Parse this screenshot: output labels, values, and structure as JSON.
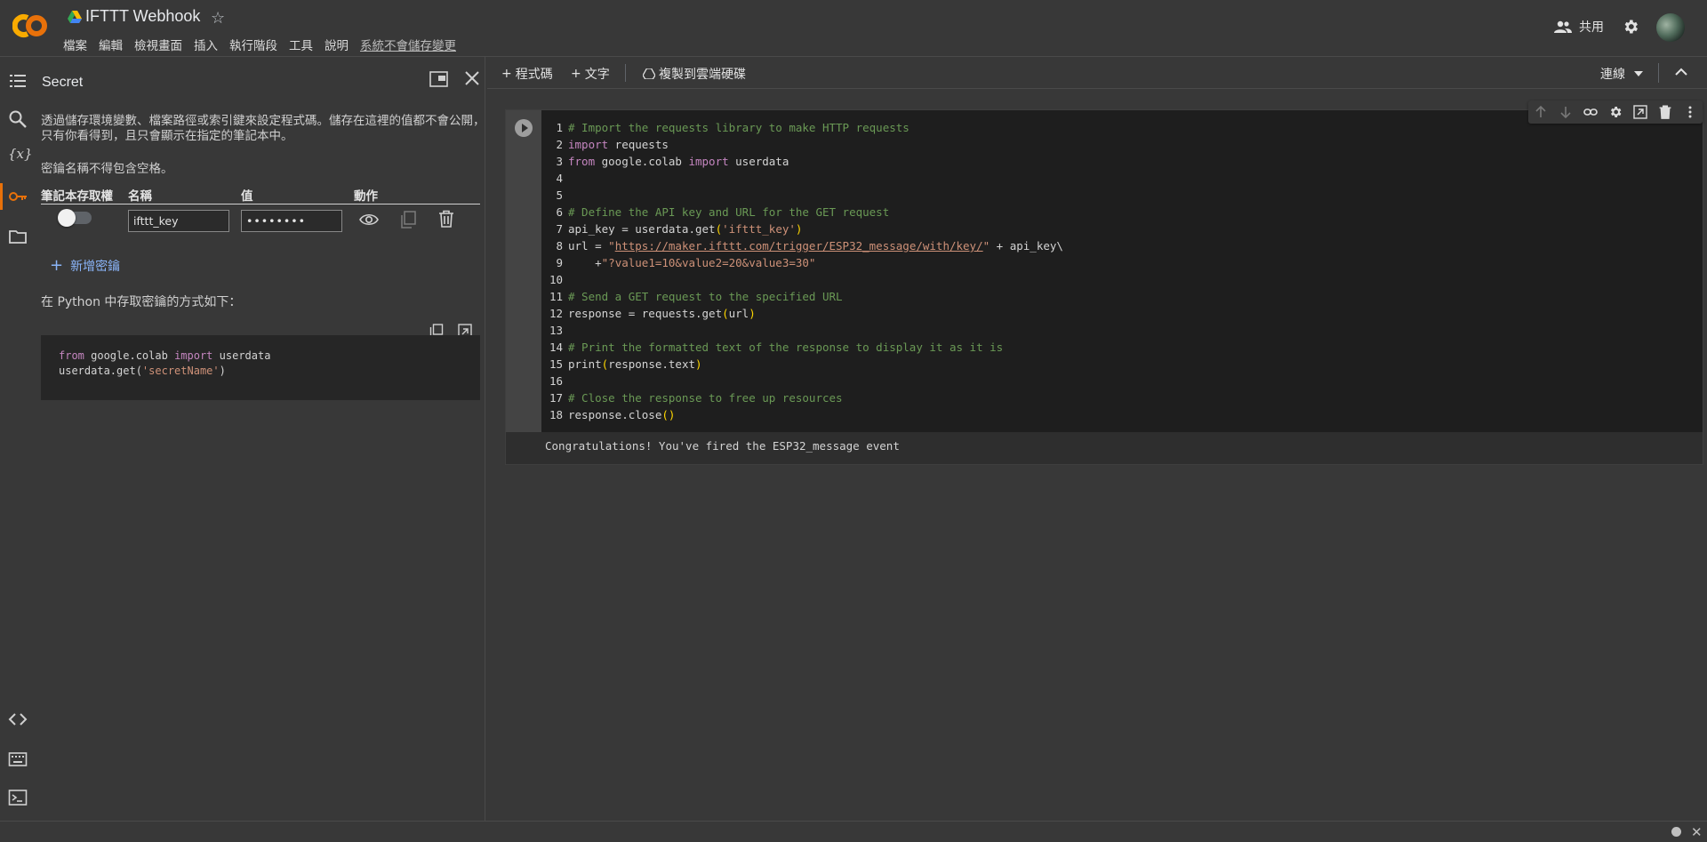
{
  "header": {
    "title": "IFTTT Webhook",
    "menu": [
      "檔案",
      "編輯",
      "檢視畫面",
      "插入",
      "執行階段",
      "工具",
      "說明"
    ],
    "unsaved_notice": "系統不會儲存變更",
    "share_label": "共用"
  },
  "side_panel": {
    "title": "Secret",
    "description": "透過儲存環境變數、檔案路徑或索引鍵來設定程式碼。儲存在這裡的值都不會公開，只有你看得到，且只會顯示在指定的筆記本中。",
    "note": "密鑰名稱不得包含空格。",
    "columns": [
      "筆記本存取權",
      "名稱",
      "值",
      "動作"
    ],
    "secret": {
      "name": "ifttt_key",
      "value_masked": "••••••••",
      "notebook_access": false
    },
    "add_secret_label": "新增密鑰",
    "python_note": "在 Python 中存取密鑰的方式如下：",
    "snippet": {
      "line1": [
        "from",
        " google.colab ",
        "import",
        " userdata"
      ],
      "line2": [
        "userdata.get(",
        "'secretName'",
        ")"
      ]
    }
  },
  "toolbar": {
    "add_code": "程式碼",
    "add_text": "文字",
    "copy_to_drive": "複製到雲端硬碟",
    "connect": "連線"
  },
  "cell": {
    "line_numbers": "1\n2\n3\n4\n5\n6\n7\n8\n9\n10\n11\n12\n13\n14\n15\n16\n17\n18",
    "code": {
      "l1": "# Import the requests library to make HTTP requests",
      "l2a": "import",
      "l2b": " requests",
      "l3a": "from",
      "l3b": " google.colab ",
      "l3c": "import",
      "l3d": " userdata",
      "l6": "# Define the API key and URL for the GET request",
      "l7a": "api_key = userdata.get",
      "l7b": "(",
      "l7c": "'ifttt_key'",
      "l7d": ")",
      "l8a": "url = ",
      "l8b": "\"",
      "l8c": "https://maker.ifttt.com/trigger/ESP32_message/with/key/",
      "l8d": "\"",
      "l8e": " + api_key\\",
      "l9a": "    +",
      "l9b": "\"?value1=10&value2=20&value3=30\"",
      "l11": "# Send a GET request to the specified URL",
      "l12a": "response = requests.get",
      "l12b": "(",
      "l12c": "url",
      "l12d": ")",
      "l14": "# Print the formatted text of the response to display it as it is",
      "l15a": "print",
      "l15b": "(",
      "l15c": "response.text",
      "l15d": ")",
      "l17": "# Close the response to free up resources",
      "l18a": "response.close",
      "l18b": "()"
    },
    "output": "Congratulations! You've fired the ESP32_message event"
  }
}
